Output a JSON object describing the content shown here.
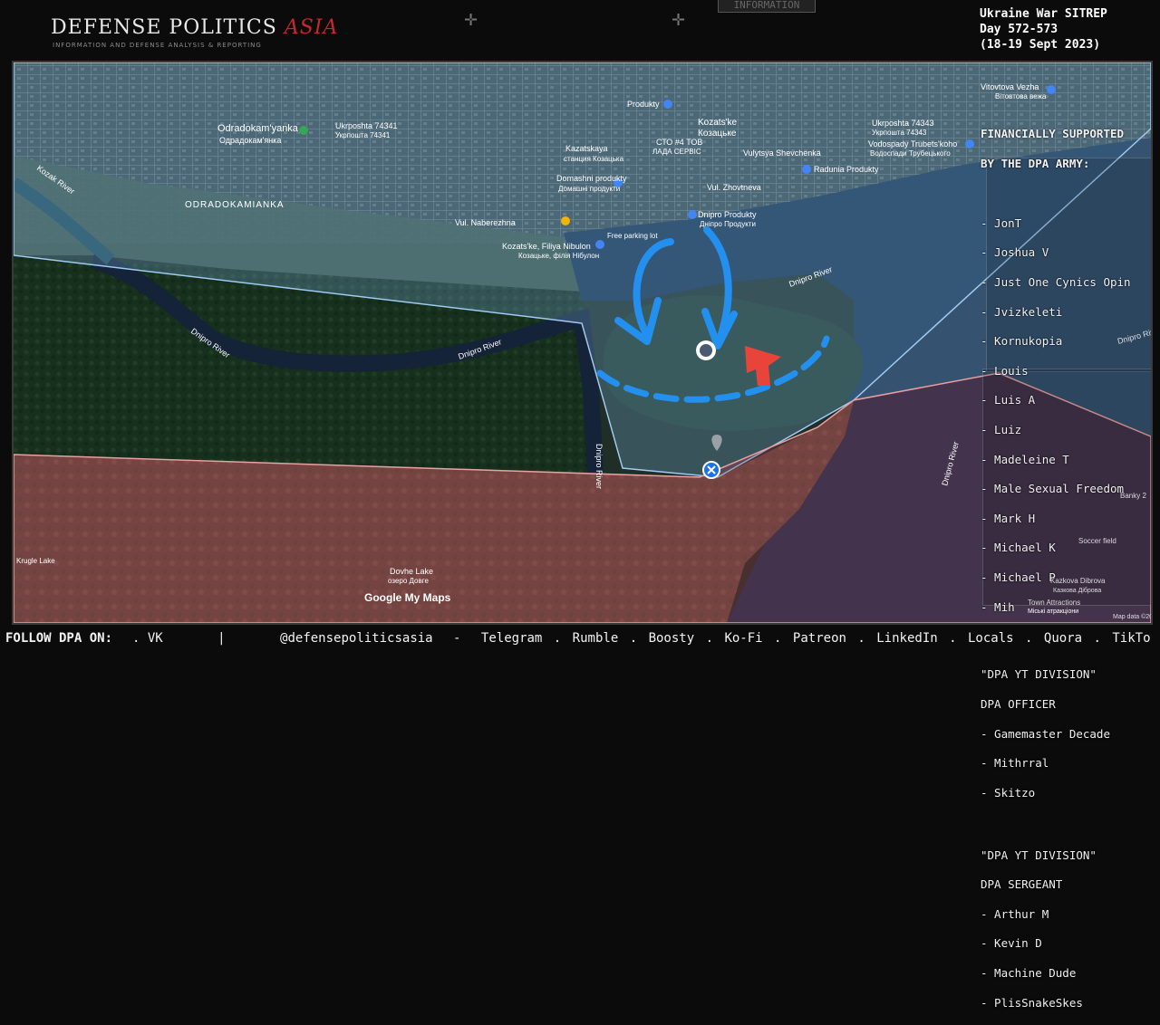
{
  "header": {
    "logo_main": "DEFENSE POLITICS",
    "logo_accent": "ASIA",
    "logo_sub": "INFORMATION AND DEFENSE ANALYSIS & REPORTING",
    "top_tag": "INFORMATION",
    "sitrep_lines": [
      "Ukraine War SITREP",
      "Day 572-573",
      "(18-19 Sept 2023)"
    ]
  },
  "map": {
    "labels": {
      "odradokamyanka": "Odradokam'yanka",
      "odradokamyanka_uk": "Одрадокам'янка",
      "odradokamianka_caps": "ODRADOKAMIANKA",
      "ukrposhta1": "Ukrposhta 74341",
      "ukrposhta1_uk": "Укрпошта 74341",
      "ukrposhta2": "Ukrposhta 74343",
      "ukrposhta2_uk": "Укрпошта 74343",
      "kozatske": "Kozats'ke",
      "kozatske_uk": "Козацьке",
      "produkty": "Produkty",
      "sto": "СТО #4 ТОВ",
      "sto2": "ЛАДА СЕРВІС",
      "kazatskaya": "Kazatskaya",
      "kazatskaya_uk": "станция Козацька",
      "shevchenka": "Vulytsya Shevchenka",
      "domashni": "Domashni produkty",
      "domashni_uk": "Домашні продукти",
      "dnipro_produkty": "Dnipro Produkty",
      "dnipro_produkty_uk": "Дніпро Продукти",
      "zhovtneva": "Vul. Zhovtneva",
      "naberezhna": "Vul. Naberezhna",
      "free_parking": "Free parking lot",
      "filiya": "Kozats'ke, Filiya Nibulon",
      "filiya_uk": "Козацьке, філія Нібулон",
      "radunia": "Radunia Produkty",
      "vodospady": "Vodospady Trubets'koho",
      "vodospady_uk": "Водоспади Трубецького",
      "vitovtova": "Vitovtova Vezha",
      "vitovtova_uk": "Вітовтова вежа",
      "kozak_river": "Kozak River",
      "dnipro_river_1": "Dnipro River",
      "dnipro_river_2": "Dnipro River",
      "dnipro_river_3": "Dnipro River",
      "dnipro_river_4": "Dnipro River",
      "dnipro_river_5": "Dnipro River",
      "dnipro_river_6": "Dnipro River",
      "dovhe_lake": "Dovhe Lake",
      "dovhe_lake_uk": "озеро Довге",
      "krugle_lake": "Krugle Lake",
      "banky": "Banky 2",
      "soccer": "Soccer field",
      "kazkova": "Kazkova Dibrova",
      "kazkova_uk": "Казкова Діброва",
      "town_attr": "Town Attractions",
      "town_attr_uk": "Міські атракціони",
      "google": "Google My Maps",
      "map_data": "Map data ©2023"
    },
    "colors": {
      "blue_overlay": "#7fb3e6",
      "red_overlay": "#b5364a",
      "arrow_blue": "#2390f0",
      "arrow_red": "#e8443a"
    }
  },
  "sidebar": {
    "supported_title_1": "FINANCIALLY SUPPORTED",
    "supported_title_2": "BY THE DPA ARMY:",
    "supporters": [
      "- JonT",
      "- Joshua V",
      "- Just One Cynics Opin",
      "- Jvizkeleti",
      "- Kornukopia",
      "- Louis",
      "- Luis A",
      "- Luiz",
      "- Madeleine T",
      "- Male Sexual Freedom",
      "- Mark H",
      "- Michael K",
      "- Michael P",
      "- Mih"
    ],
    "officer_title_1": "\"DPA YT DIVISION\"",
    "officer_title_2": "DPA OFFICER",
    "officers": [
      "- Gamemaster Decade",
      "- Mithrral",
      "- Skitzo"
    ],
    "sergeant_title_1": "\"DPA YT DIVISION\"",
    "sergeant_title_2": "DPA SERGEANT",
    "sergeants": [
      "- Arthur M",
      "- Kevin D",
      "- Machine Dude",
      "- PlisSnakeSkes"
    ]
  },
  "footer": {
    "label": "FOLLOW DPA ON:",
    "links": [
      ". VK",
      "|",
      "@defensepoliticsasia",
      "-",
      "Telegram",
      ".",
      "Rumble",
      ".",
      "Boosty",
      ".",
      "Ko-Fi",
      ".",
      "Patreon",
      ".",
      "LinkedIn",
      ".",
      "Locals",
      ".",
      "Quora",
      ".",
      "TikTo"
    ]
  }
}
